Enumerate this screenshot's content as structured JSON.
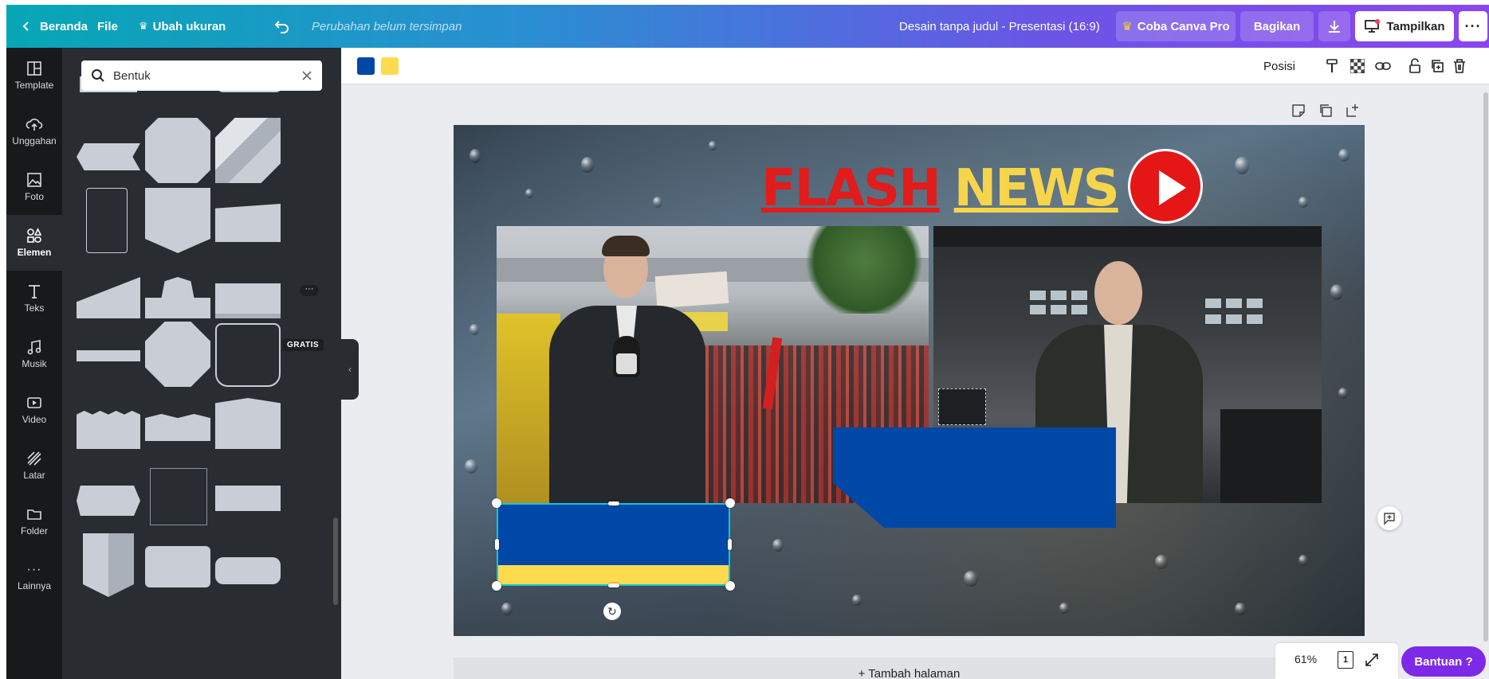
{
  "topbar": {
    "home_label": "Beranda",
    "file_label": "File",
    "resize_label": "Ubah ukuran",
    "unsaved_label": "Perubahan belum tersimpan",
    "doc_title": "Desain tanpa judul - Presentasi (16:9)",
    "pro_label": "Coba Canva Pro",
    "share_label": "Bagikan",
    "present_label": "Tampilkan"
  },
  "rail": {
    "items": [
      {
        "label": "Template",
        "icon": "template-icon"
      },
      {
        "label": "Unggahan",
        "icon": "upload-cloud-icon"
      },
      {
        "label": "Foto",
        "icon": "photo-icon"
      },
      {
        "label": "Elemen",
        "icon": "elements-icon"
      },
      {
        "label": "Teks",
        "icon": "text-icon"
      },
      {
        "label": "Musik",
        "icon": "music-icon"
      },
      {
        "label": "Video",
        "icon": "video-icon"
      },
      {
        "label": "Latar",
        "icon": "background-icon"
      },
      {
        "label": "Folder",
        "icon": "folder-icon"
      },
      {
        "label": "Lainnya",
        "icon": "more-icon"
      }
    ]
  },
  "panel": {
    "search_value": "Bentuk",
    "badge_free": "GRATIS",
    "more_badge": "···"
  },
  "context_bar": {
    "colors": [
      "#0048a8",
      "#fedb4f"
    ],
    "position_label": "Posisi"
  },
  "canvas": {
    "title_word1": "FLASH",
    "title_word2": "NEWS",
    "colors": {
      "flash": "#e21b1b",
      "news": "#f7d54b",
      "shape_blue": "#0048a8",
      "shape_yellow": "#fedb4f",
      "selection": "#13c6d8"
    }
  },
  "footer": {
    "add_page_label": "+ Tambah halaman",
    "zoom": "61%",
    "page_number": "1",
    "help_label": "Bantuan  ?"
  }
}
